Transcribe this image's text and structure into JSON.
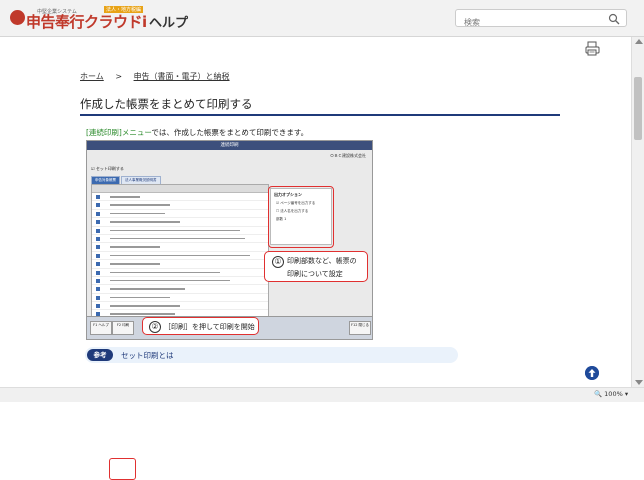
{
  "header": {
    "logo_small": "中堅企業システム",
    "logo_main": "申告奉行クラウドi",
    "logo_tag": "法人・地方税編",
    "help_title": "ヘルプ",
    "search_placeholder": "検索"
  },
  "breadcrumb": {
    "home": "ホーム",
    "separator": ">",
    "current": "申告（書面・電子）と納税"
  },
  "page": {
    "title": "作成した帳票をまとめて印刷する",
    "intro_em": "[連続印刷]メニュー",
    "intro_rest": "では、作成した帳票をまとめて印刷できます。"
  },
  "screenshot": {
    "window_title": "連続印刷",
    "company": "ＯＢＣ建設株式会社",
    "set_print": "セット印刷する",
    "tab1": "申告対象帳票",
    "tab2": "法人事業概況説明書",
    "options_title": "出力オプション",
    "option1": "ページ番号を出力する",
    "option2": "法人名を出力する",
    "copies_label": "部数",
    "f1": "F1 ヘルプ",
    "f2": "F2 印刷",
    "f12": "F12 閉じる"
  },
  "callouts": {
    "c1_num": "①",
    "c1_line1": "印刷部数など、帳票の",
    "c1_line2": "印刷について設定",
    "c2_num": "②",
    "c2_text": "［印刷］を押して印刷を開始"
  },
  "reference": {
    "badge": "参考",
    "link": "セット印刷とは"
  },
  "status": {
    "zoom": "100%"
  },
  "colors": {
    "accent": "#1f3a7a",
    "highlight": "#e03030",
    "menu_green": "#2a8a2a"
  }
}
